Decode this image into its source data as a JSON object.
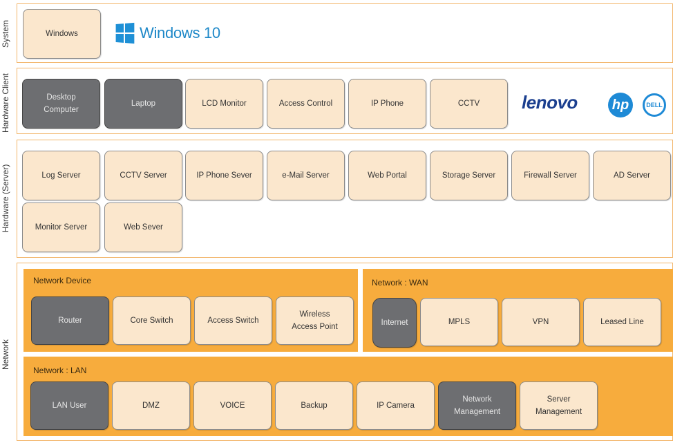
{
  "layers": {
    "system": "System",
    "client": "Hardware Client",
    "server": "Hardware (Server)",
    "network": "Network"
  },
  "system": {
    "windows_box": "Windows",
    "windows_logo_text": "Windows 10"
  },
  "client": {
    "items": [
      "Desktop\nComputer",
      "Laptop",
      "LCD Monitor",
      "Access Control",
      "IP Phone",
      "CCTV"
    ],
    "brands": {
      "lenovo": "lenovo",
      "hp": "hp",
      "dell": "DELL"
    }
  },
  "server": {
    "items": [
      "Log Server",
      "CCTV Server",
      "IP Phone Sever",
      "e-Mail Server",
      "Web Portal",
      "Storage Server",
      "Firewall Server",
      "AD Server",
      "Monitor Server",
      "Web Sever"
    ]
  },
  "network_device": {
    "title": "Network Device",
    "items": [
      "Router",
      "Core Switch",
      "Access Switch",
      "Wireless\nAccess Point"
    ]
  },
  "network_wan": {
    "title": "Network : WAN",
    "items": [
      "Internet",
      "MPLS",
      "VPN",
      "Leased Line"
    ]
  },
  "network_lan": {
    "title": "Network : LAN",
    "items": [
      "LAN User",
      "DMZ",
      "VOICE",
      "Backup",
      "IP Camera",
      "Network\nManagement",
      "Server\nManagement"
    ]
  },
  "colors": {
    "band_border": "#f2b468",
    "box_fill": "#fbe7cd",
    "box_dark": "#6d6e71",
    "network_orange": "#f7ac3d",
    "windows_blue": "#1e88c8",
    "lenovo_blue": "#1b3f8f"
  }
}
